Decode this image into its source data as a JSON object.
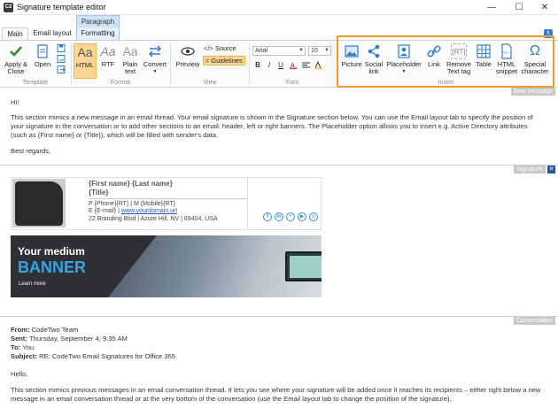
{
  "window": {
    "app_icon_text": "C2",
    "title": "Signature template editor",
    "minimize": "—",
    "maximize": "☐",
    "close": "✕"
  },
  "ribbon_context": {
    "header": "Paragraph"
  },
  "tabs": [
    {
      "label": "Main",
      "active": true
    },
    {
      "label": "Email layout",
      "active": false
    },
    {
      "label": "Formatting",
      "active": false
    }
  ],
  "info_icon": "i",
  "groups": {
    "template": {
      "label": "Template",
      "apply_close": "Apply &\nClose",
      "open": "Open"
    },
    "format": {
      "label": "Format",
      "html": "HTML",
      "rtf": "RTF",
      "plain_text": "Plain\ntext",
      "convert": "Convert"
    },
    "view": {
      "label": "View",
      "preview": "Preview",
      "source": "Source",
      "guidelines": "Guidelines"
    },
    "font": {
      "label": "Font",
      "font_name": "Arial",
      "font_size": "10",
      "bold": "B",
      "italic": "I",
      "underline": "U"
    },
    "insert": {
      "label": "Insert",
      "picture": "Picture",
      "social_link": "Social\nlink",
      "placeholder": "Placeholder",
      "link": "Link",
      "remove_text_tag": "Remove\nText tag",
      "table": "Table",
      "html_snippet": "HTML\nsnippet",
      "special_character": "Special\ncharacter"
    }
  },
  "sections": {
    "new_message": {
      "label": "New message",
      "greeting": "Hi!",
      "body": "This section mimics a new message in an email thread. Your email signature is shown in the Signature section below. You can use the Email layout tab to specify the position of your signature in the conversation or to add other sections to an email: header, left or right banners. The Placeholder option allows you to insert e.g. Active Directory attributes (such as {First name} or {Title}), which will be filled with sender's data.",
      "closing": "Best regards,"
    },
    "signature": {
      "label": "Signature",
      "close_icon": "✕",
      "name": "{First name} {Last name}",
      "title": "{Title}",
      "phone_line": "P {Phone}{RT} | M {Mobile}{RT}",
      "email_prefix": "E {E-mail} | ",
      "website": "www.yourdomain.url",
      "address": "22 Branding Blvd | Azure Hill, NV | 89404, USA",
      "social": [
        "f",
        "in",
        "ᵛ",
        "▶",
        "◎"
      ],
      "banner": {
        "line1": "Your medium",
        "line2": "BANNER",
        "line3": "Learn more"
      }
    },
    "conversation": {
      "label": "Conversation",
      "from_label": "From:",
      "from": "CodeTwo Team",
      "sent_label": "Sent:",
      "sent": "Thursday, September 4, 9:35 AM",
      "to_label": "To:",
      "to": "You",
      "subject_label": "Subject:",
      "subject": "RE: CodeTwo Email Signatures for Office 365",
      "greeting": "Hello,",
      "body": "This section mimics previous messages in an email conversation thread. It lets you see where your signature will be added once it reaches its recipients – either right below a new message in an email conversation thread or at the very bottom of the conversation (use the Email layout tab to change the position of the signature)."
    }
  },
  "colors": {
    "accent": "#2f7fd1",
    "selected": "#fbd694",
    "insert_highlight": "#f29a2e",
    "banner_blue": "#33a6e8"
  }
}
